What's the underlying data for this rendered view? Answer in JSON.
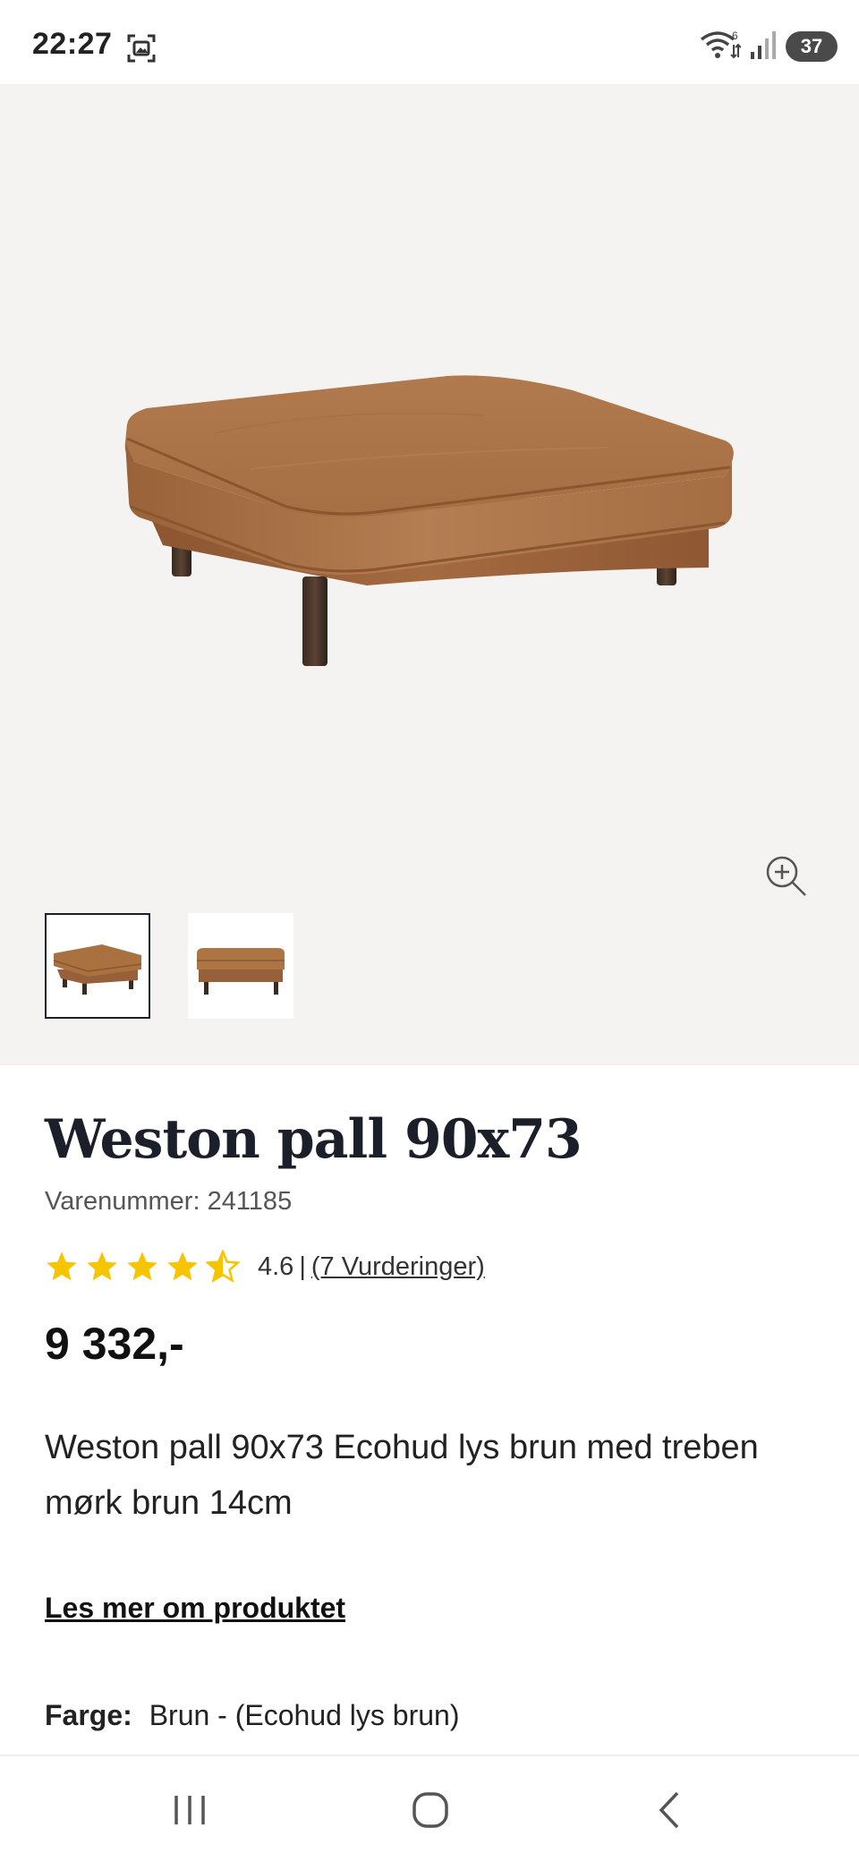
{
  "status_bar": {
    "time": "22:27",
    "battery": "37",
    "icons": [
      "screenshot-icon",
      "wifi-icon",
      "signal-icon",
      "battery-icon"
    ]
  },
  "gallery": {
    "main_image": "brown-leather-ottoman",
    "thumbnails": [
      "ottoman-front-view",
      "ottoman-side-view"
    ],
    "selected_thumbnail": 0,
    "zoom_icon": "zoom-in-icon"
  },
  "product": {
    "title": "Weston pall 90x73",
    "sku": "Varenummer: 241185",
    "rating": {
      "value": "4.6",
      "separator": "|",
      "reviews_text": "(7 Vurderinger)",
      "stars": 4.6,
      "star_color": "#f7c400"
    },
    "price": "9 332,-",
    "description": "Weston pall 90x73 Ecohud lys brun med treben mørk brun 14cm",
    "read_more": "Les mer om produktet",
    "color_label": "Farge:",
    "color_value": "Brun - (Ecohud lys brun)"
  },
  "nav_bar": {
    "icons": [
      "recents-icon",
      "home-icon",
      "back-icon"
    ]
  }
}
